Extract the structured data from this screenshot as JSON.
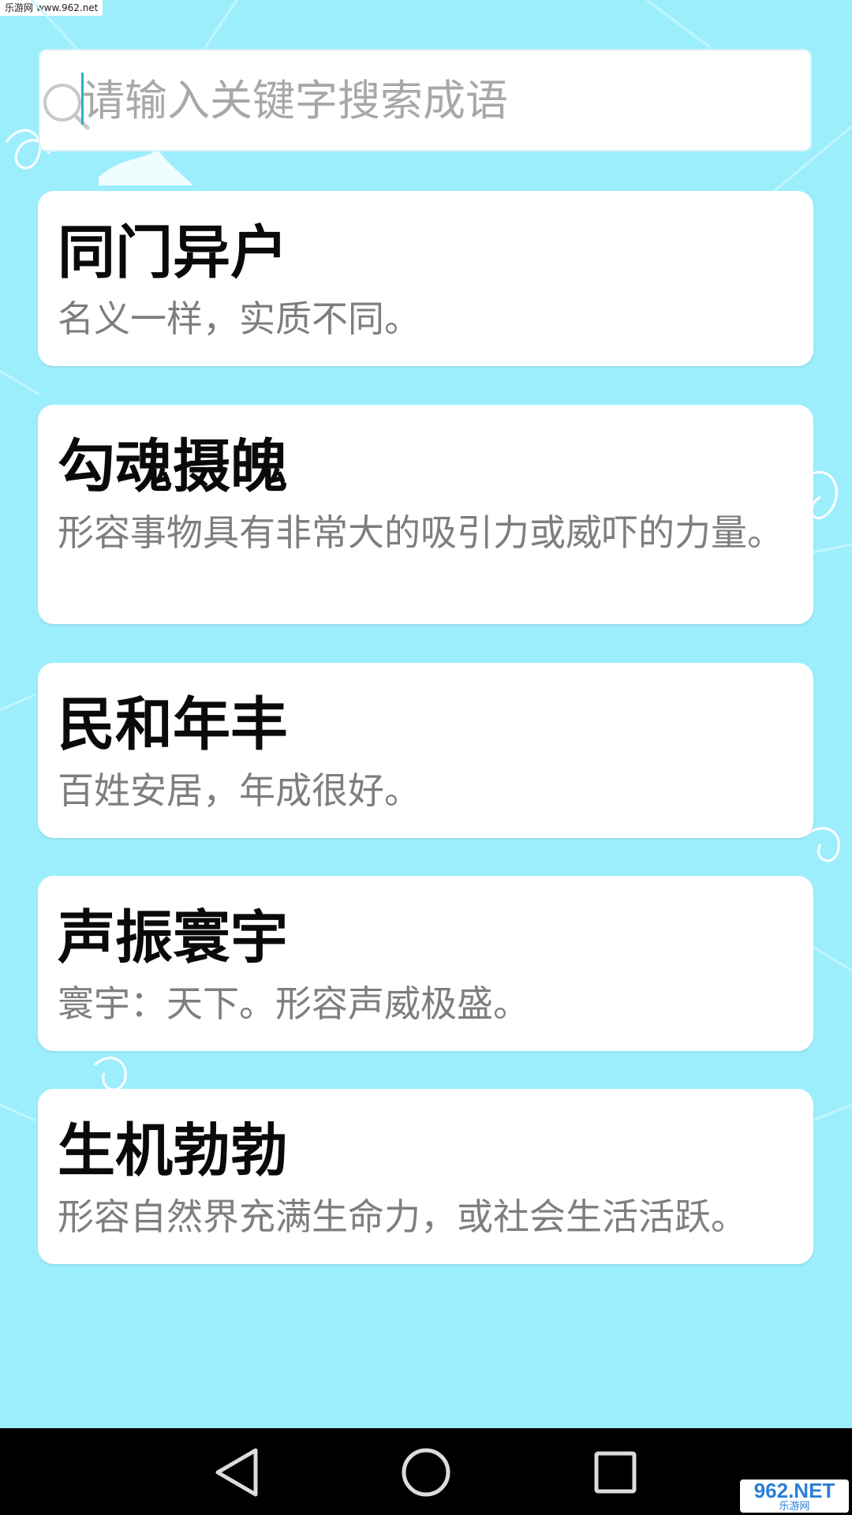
{
  "watermark_top": "乐游网 www.962.net",
  "search": {
    "placeholder": "请输入关键字搜索成语",
    "value": ""
  },
  "idioms": [
    {
      "title": "同门异户",
      "desc": "名义一样，实质不同。"
    },
    {
      "title": "勾魂摄魄",
      "desc": "形容事物具有非常大的吸引力或威吓的力量。"
    },
    {
      "title": "民和年丰",
      "desc": "百姓安居，年成很好。"
    },
    {
      "title": "声振寰宇",
      "desc": "寰宇：天下。形容声威极盛。"
    },
    {
      "title": "生机勃勃",
      "desc": "形容自然界充满生命力，或社会生活活跃。"
    }
  ],
  "nav": {
    "back_icon": "back-triangle-icon",
    "home_icon": "home-circle-icon",
    "recents_icon": "recents-square-icon"
  },
  "watermark_bottom": {
    "main": "962.NET",
    "sub": "乐游网"
  },
  "colors": {
    "background": "#9deefc",
    "card": "#ffffff",
    "title": "#0a0a0a",
    "desc": "#7e7e7e",
    "accent": "#2bb3c0",
    "nav": "#000000"
  }
}
